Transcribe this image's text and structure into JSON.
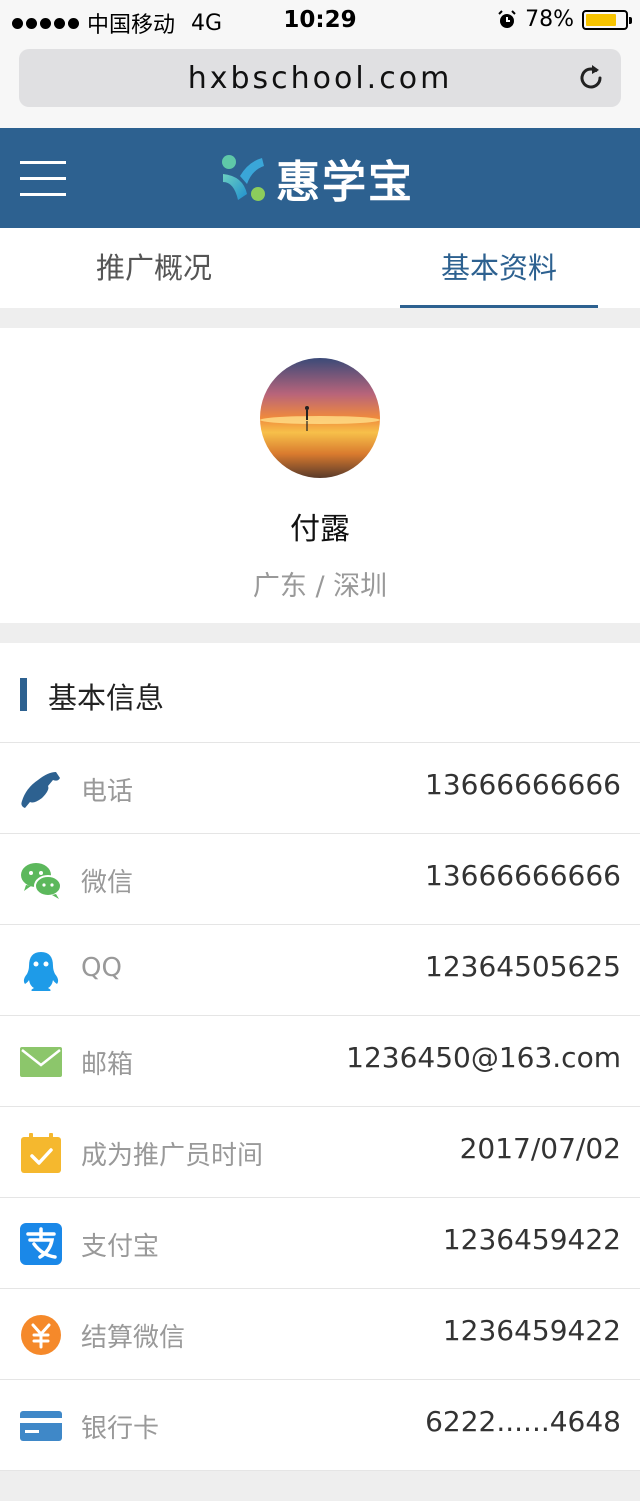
{
  "statusbar": {
    "carrier": "中国移动",
    "network": "4G",
    "time": "10:29",
    "battery_text": "78%",
    "battery_level": 0.78,
    "battery_color": "#f6c300"
  },
  "browser": {
    "url": "hxbschool.com",
    "reload_icon": "reload-icon"
  },
  "header": {
    "brand": "惠学宝",
    "menu_icon": "hamburger-menu-icon",
    "bg_color": "#2d6190"
  },
  "tabs": [
    {
      "label": "推广概况",
      "active": false
    },
    {
      "label": "基本资料",
      "active": true
    }
  ],
  "profile": {
    "name": "付露",
    "location": "广东 / 深圳"
  },
  "info": {
    "title": "基本信息",
    "rows": [
      {
        "icon": "phone-icon",
        "label": "电话",
        "value": "13666666666",
        "color": "#2d6190"
      },
      {
        "icon": "wechat-icon",
        "label": "微信",
        "value": "13666666666",
        "color": "#5cb85c"
      },
      {
        "icon": "qq-icon",
        "label": "QQ",
        "value": "12364505625",
        "color": "#1e9be8"
      },
      {
        "icon": "mail-icon",
        "label": "邮箱",
        "value": "1236450@163.com",
        "color": "#8cc66b"
      },
      {
        "icon": "calendar-check-icon",
        "label": "成为推广员时间",
        "value": "2017/07/02",
        "color": "#f5b82e"
      },
      {
        "icon": "alipay-icon",
        "label": "支付宝",
        "value": "1236459422",
        "color": "#1a88e8"
      },
      {
        "icon": "yuan-coin-icon",
        "label": "结算微信",
        "value": "1236459422",
        "color": "#f5892a"
      },
      {
        "icon": "bank-card-icon",
        "label": "银行卡",
        "value": "6222......4648",
        "color": "#3f88c8"
      }
    ]
  }
}
